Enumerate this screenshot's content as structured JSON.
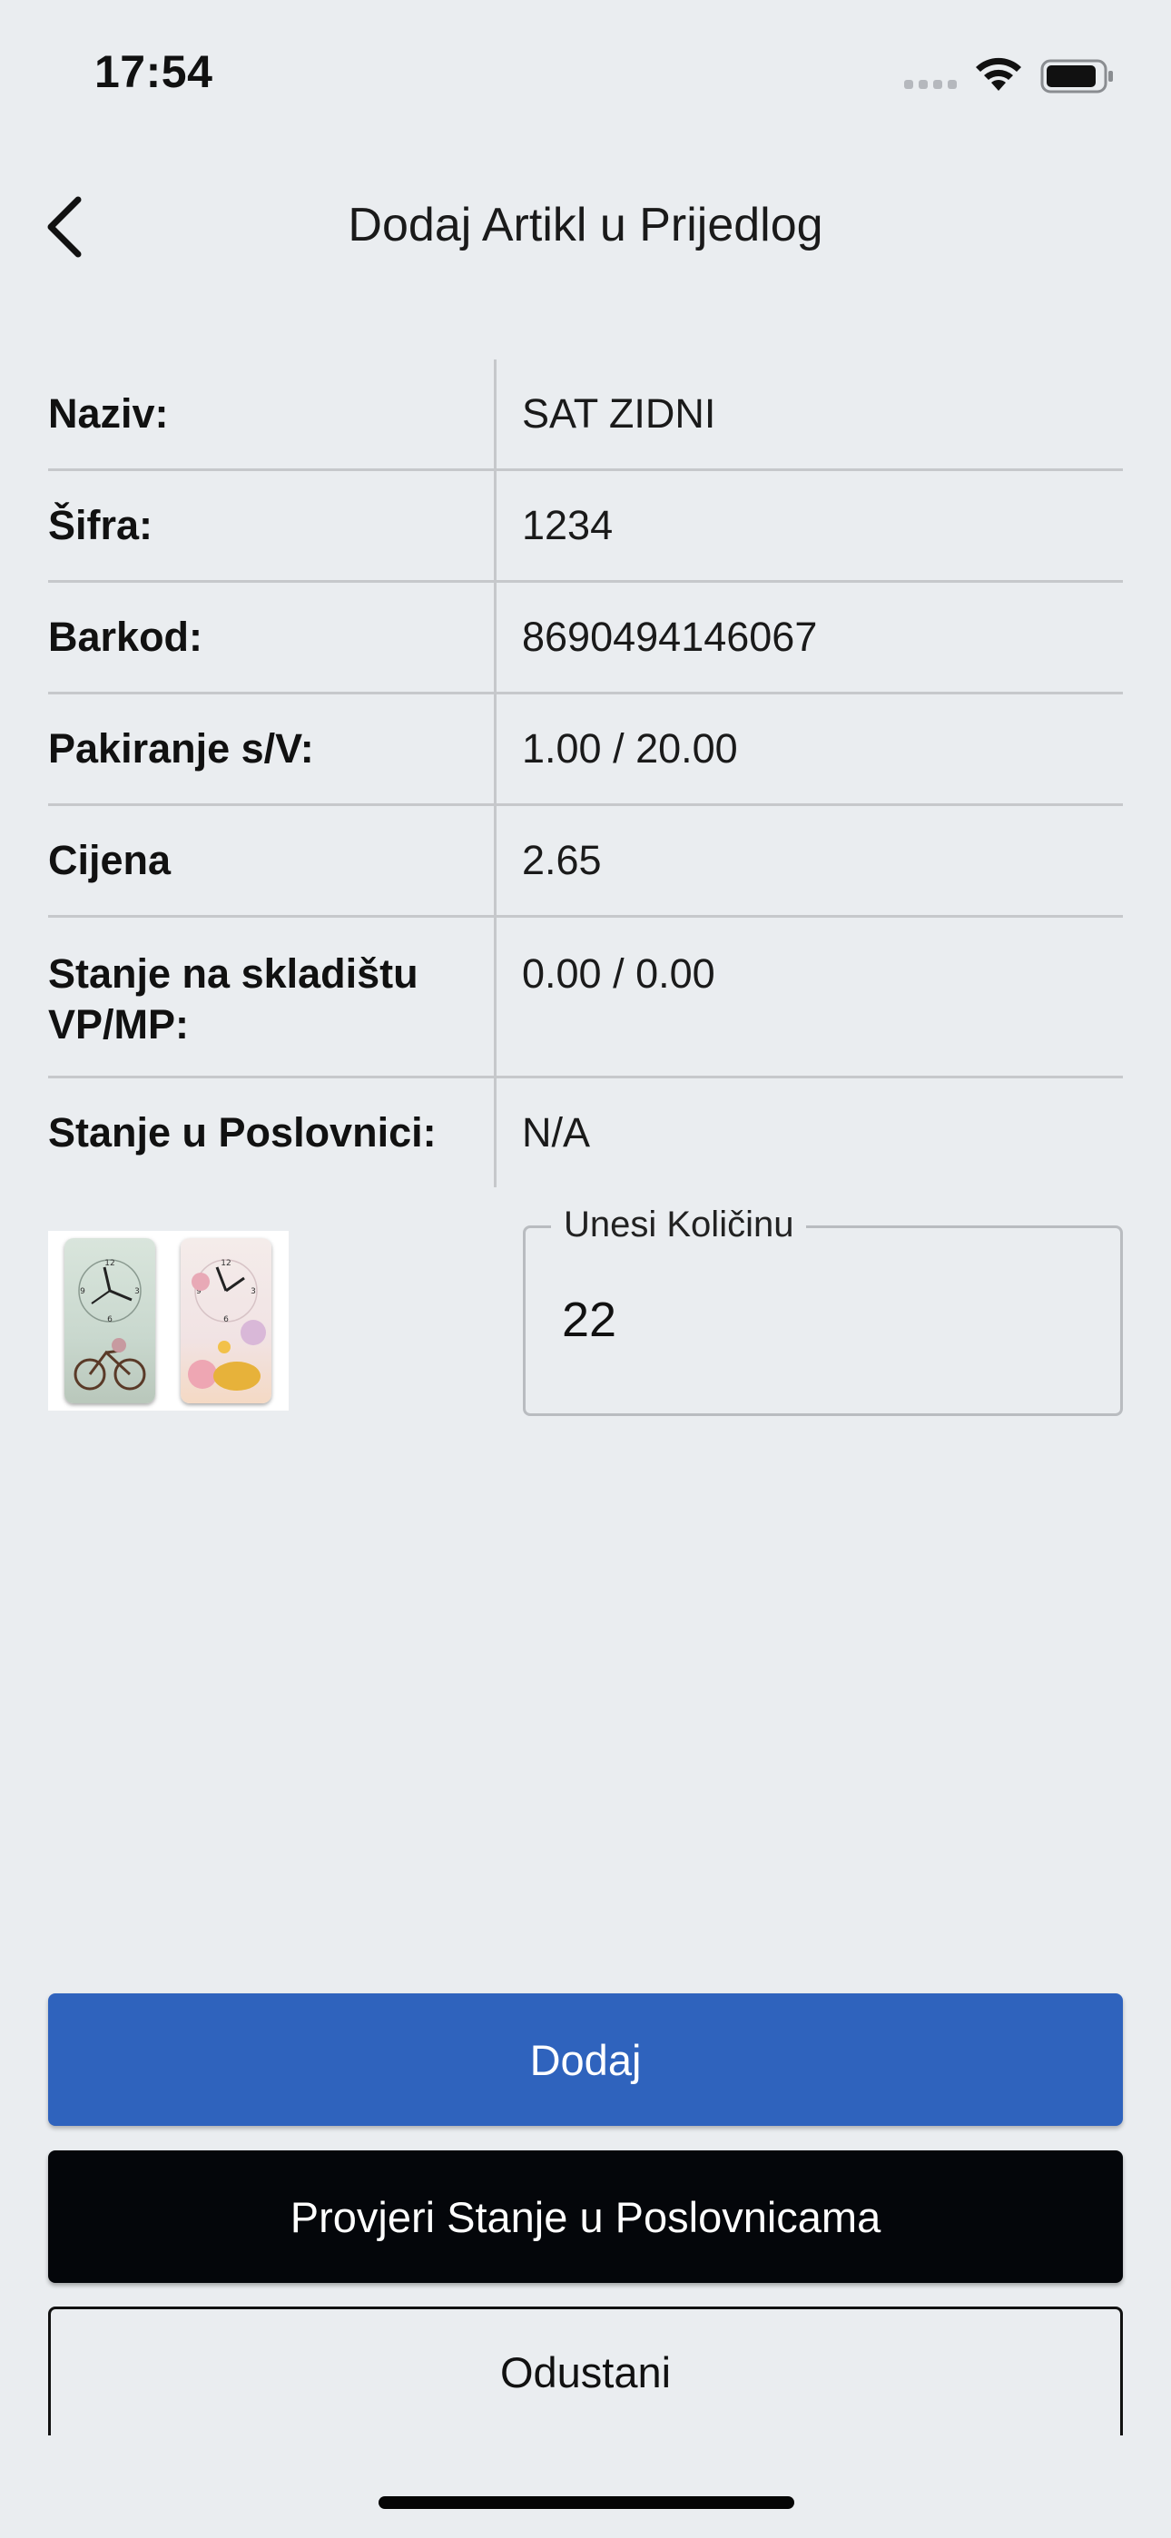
{
  "status_bar": {
    "time": "17:54"
  },
  "header": {
    "title": "Dodaj Artikl u Prijedlog",
    "back_icon": "chevron-left-icon"
  },
  "details": [
    {
      "label": "Naziv:",
      "value": "SAT ZIDNI"
    },
    {
      "label": "Šifra:",
      "value": "1234"
    },
    {
      "label": "Barkod:",
      "value": "8690494146067"
    },
    {
      "label": "Pakiranje s/V:",
      "value": "1.00 / 20.00"
    },
    {
      "label": "Cijena",
      "value": "2.65"
    },
    {
      "label": "Stanje na skladištu VP/MP:",
      "value": "0.00 / 0.00"
    },
    {
      "label": "Stanje u Poslovnici:",
      "value": "N/A"
    }
  ],
  "quantity": {
    "label": "Unesi Količinu",
    "value": "22"
  },
  "buttons": {
    "add": "Dodaj",
    "check_stock": "Provjeri Stanje u Poslovnicama",
    "cancel": "Odustani"
  },
  "colors": {
    "background": "#eaedf0",
    "primary": "#2f63bd",
    "dark": "#04060a",
    "divider": "#c6c8cb"
  }
}
